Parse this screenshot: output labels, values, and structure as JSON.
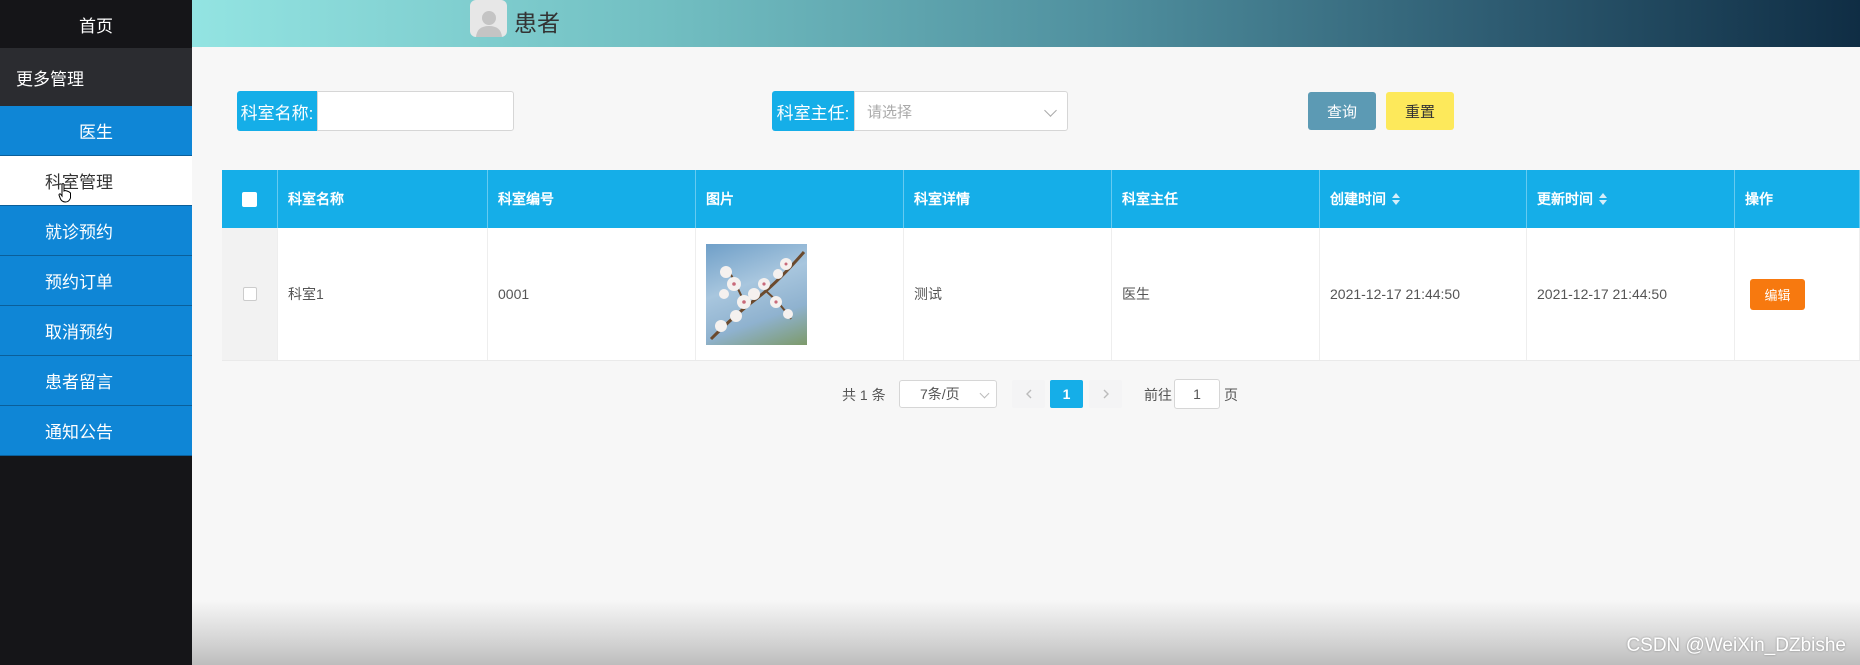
{
  "sidebar": {
    "home": "首页",
    "group": "更多管理",
    "items": [
      {
        "label": "医生"
      },
      {
        "label": "科室管理"
      },
      {
        "label": "就诊预约"
      },
      {
        "label": "预约订单"
      },
      {
        "label": "取消预约"
      },
      {
        "label": "患者留言"
      },
      {
        "label": "通知公告"
      }
    ]
  },
  "header": {
    "title": "患者",
    "avatar_icon": "user-icon"
  },
  "search": {
    "name_label": "科室名称:",
    "name_value": "",
    "director_label": "科室主任:",
    "director_placeholder": "请选择",
    "query_button": "查询",
    "reset_button": "重置"
  },
  "table": {
    "columns": [
      "科室名称",
      "科室编号",
      "图片",
      "科室详情",
      "科室主任",
      "创建时间",
      "更新时间",
      "操作"
    ],
    "rows": [
      {
        "name": "科室1",
        "code": "0001",
        "detail": "测试",
        "director": "医生",
        "created": "2021-12-17 21:44:50",
        "updated": "2021-12-17 21:44:50",
        "action": "编辑"
      }
    ]
  },
  "pagination": {
    "total": "共 1 条",
    "page_size": "7条/页",
    "current_page": "1",
    "goto_label": "前往",
    "goto_value": "1",
    "goto_unit": "页"
  },
  "watermark": "CSDN @WeiXin_DZbishe",
  "colors": {
    "accent": "#15aee8",
    "sidebar_item": "#0f86d6",
    "sidebar_bg": "#151518",
    "edit_button": "#f7790f",
    "reset_button": "#fde95b",
    "query_button": "#5c9ab4"
  }
}
